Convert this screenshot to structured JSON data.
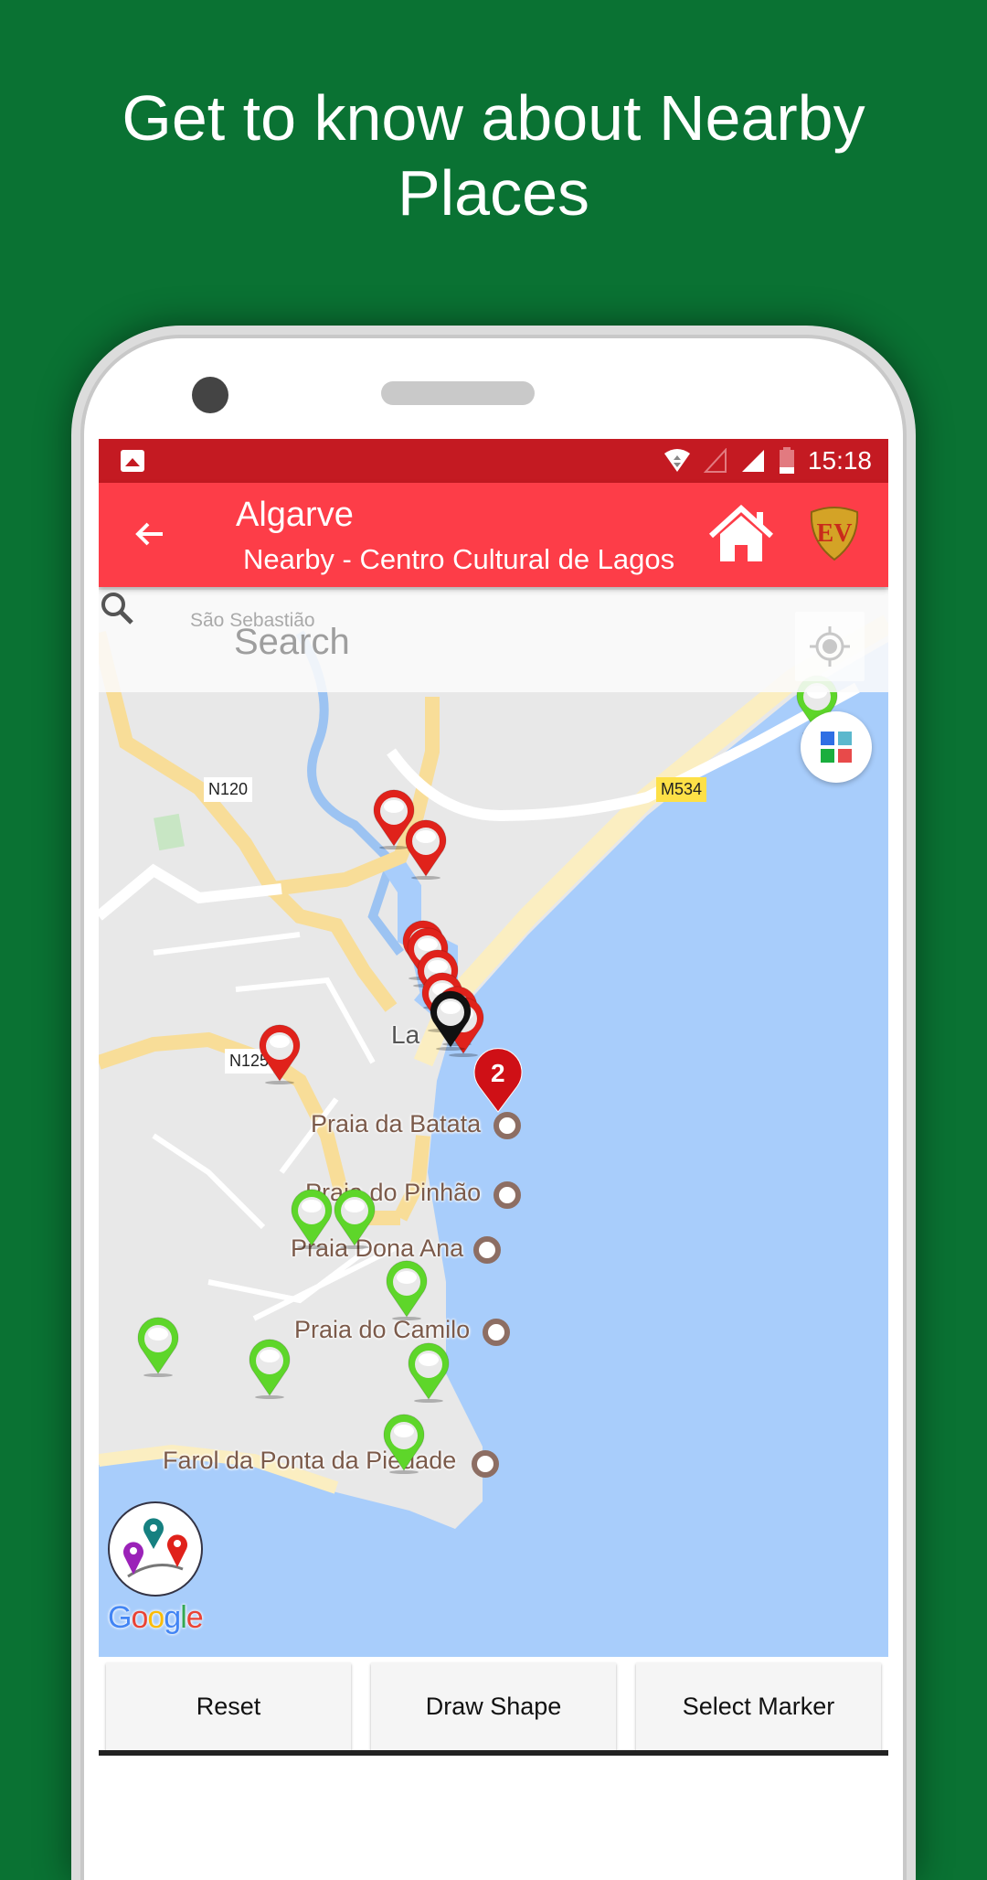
{
  "headline": {
    "line1": "Get to know about Nearby",
    "line2": "Places"
  },
  "status_bar": {
    "time": "15:18",
    "icons": [
      "image-notification-icon",
      "wifi-icon",
      "signal-empty-icon",
      "signal-full-icon",
      "battery-low-icon"
    ]
  },
  "app_bar": {
    "title": "Algarve",
    "subtitle": "Nearby - Centro Cultural de Lagos",
    "back_icon": "arrow-left-icon",
    "home_icon": "home-icon",
    "logo_icon": "ev-shield-logo",
    "accent_color": "#fd3d48",
    "status_color": "#c41a22"
  },
  "search": {
    "placeholder": "Search",
    "icon": "search-icon",
    "locate_icon": "my-location-icon"
  },
  "map": {
    "labels": {
      "town_faded": "São Sebastião",
      "town": "La",
      "places": [
        "Praia da Batata",
        "Praia do Pinhão",
        "Praia Dona Ana",
        "Praia do Camilo",
        "Farol da Ponta da Piedade"
      ],
      "roads": [
        "N120",
        "M534",
        "N125"
      ]
    },
    "cluster_count": "2",
    "markers": {
      "red_count": 9,
      "green_count": 8
    },
    "attribution": "Google",
    "layers_button_icon": "layers-grid-icon"
  },
  "buttons": {
    "reset": "Reset",
    "draw_shape": "Draw Shape",
    "select_marker": "Select Marker"
  },
  "colors": {
    "background": "#0a7233",
    "water": "#a8cdfb",
    "land": "#e8e8e8",
    "beach": "#fbeec1",
    "red_pin": "#e0221b",
    "green_pin": "#5ed62a"
  }
}
